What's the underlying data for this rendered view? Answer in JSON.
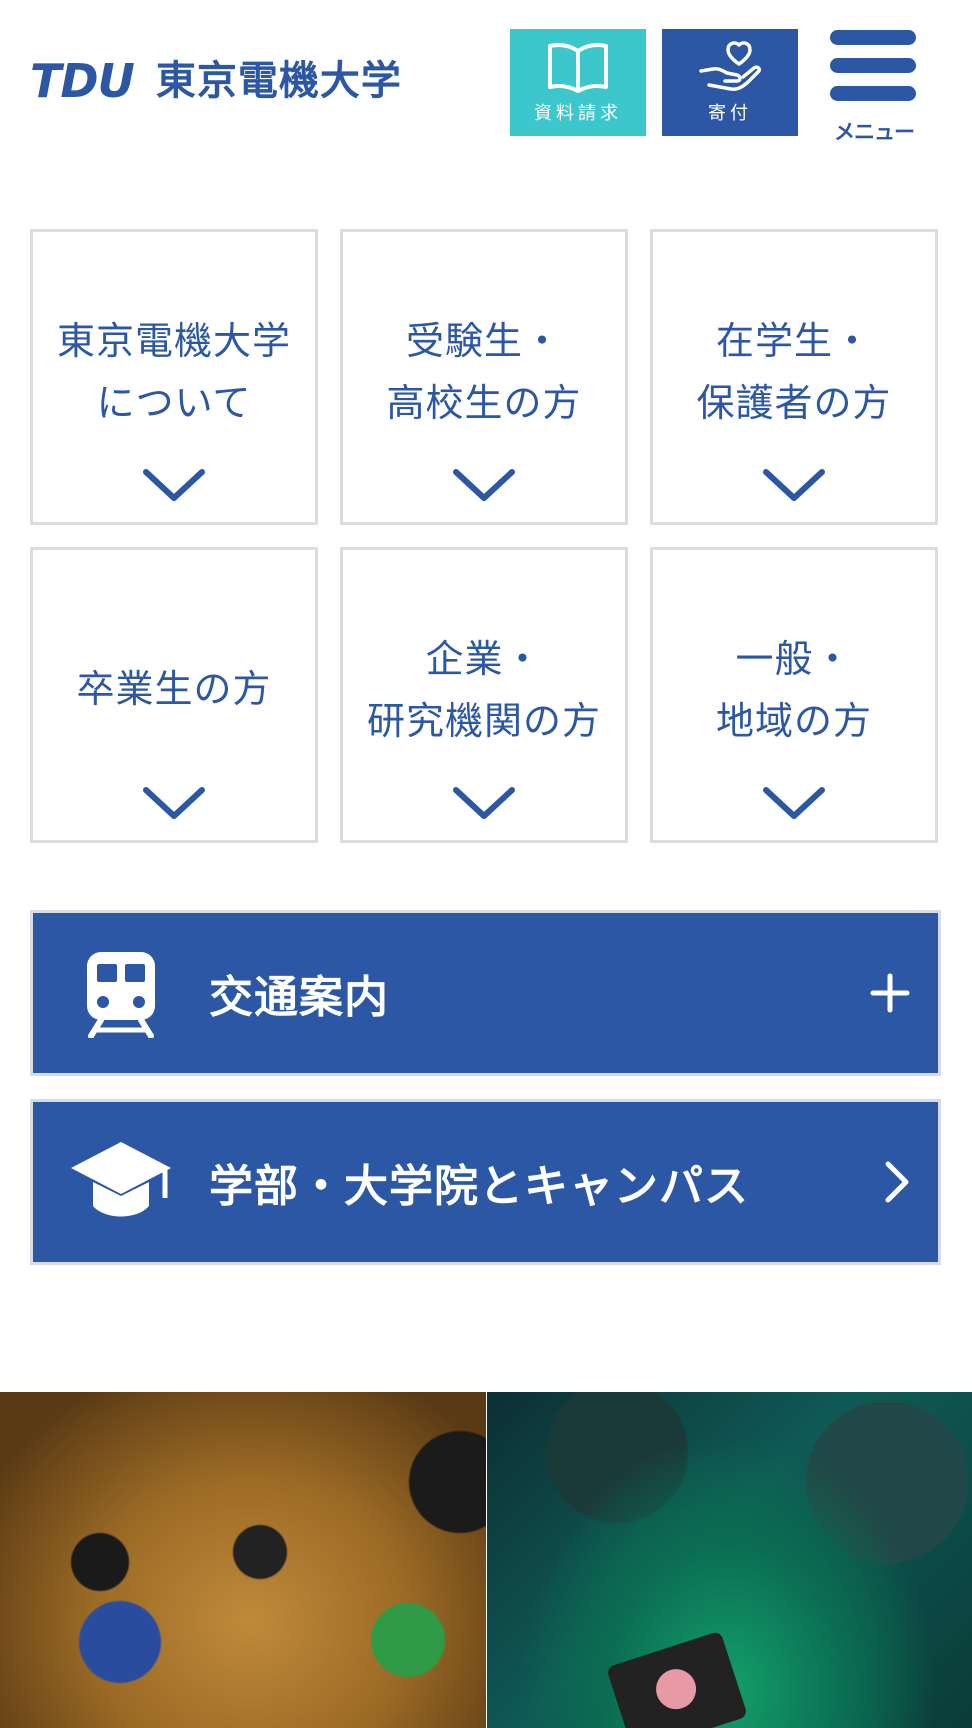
{
  "header": {
    "logo_roman": "TDU",
    "logo_japanese": "東京電機大学",
    "doc_request_label": "資料請求",
    "donation_label": "寄付",
    "menu_label": "メニュー"
  },
  "nav_cards": [
    {
      "line1": "東京電機大学",
      "line2": "について"
    },
    {
      "line1": "受験生・",
      "line2": "高校生の方"
    },
    {
      "line1": "在学生・",
      "line2": "保護者の方"
    },
    {
      "line1": "卒業生の方",
      "line2": ""
    },
    {
      "line1": "企業・",
      "line2": "研究機関の方"
    },
    {
      "line1": "一般・",
      "line2": "地域の方"
    }
  ],
  "access": {
    "label": "交通案内",
    "icon": "train-icon",
    "action": "+"
  },
  "campus": {
    "label": "学部・大学院とキャンパス",
    "icon": "graduation-cap-icon"
  },
  "colors": {
    "brand": "#2b57a4",
    "accent": "#3cc7cd",
    "card_border": "#dcdcdc"
  }
}
